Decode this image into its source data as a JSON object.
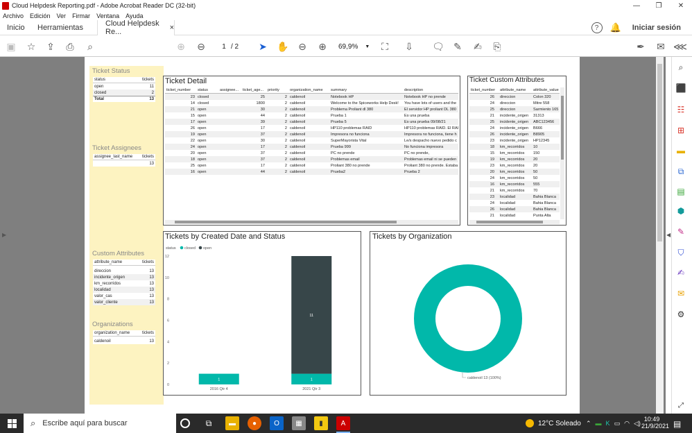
{
  "window": {
    "title": "Cloud Helpdesk Reporting.pdf - Adobe Acrobat Reader DC (32-bit)",
    "min": "—",
    "max": "❐",
    "close": "✕"
  },
  "menu": [
    "Archivo",
    "Edición",
    "Ver",
    "Firmar",
    "Ventana",
    "Ayuda"
  ],
  "tabs": {
    "home": "Inicio",
    "tools": "Herramientas",
    "doc": "Cloud Helpdesk Re...",
    "close": "×",
    "signin": "Iniciar sesión"
  },
  "toolbar": {
    "page_current": "1",
    "page_total": "/ 2",
    "zoom": "69,9%"
  },
  "report": {
    "ticket_status": {
      "title": "Ticket Status",
      "headers": [
        "status",
        "tickets"
      ],
      "rows": [
        [
          "open",
          "11"
        ],
        [
          "closed",
          "2"
        ]
      ],
      "total": [
        "Total",
        "13"
      ]
    },
    "ticket_assignees": {
      "title": "Ticket Assignees",
      "headers": [
        "assignee_last_name",
        "tickets"
      ],
      "rows": [
        [
          "",
          "13"
        ]
      ]
    },
    "custom_attributes": {
      "title": "Custom Attributes",
      "headers": [
        "attribute_name",
        "tickets"
      ],
      "rows": [
        [
          "direccion",
          "13"
        ],
        [
          "incidente_origen",
          "13"
        ],
        [
          "km_recorridos",
          "13"
        ],
        [
          "localidad",
          "13"
        ],
        [
          "valor_cas",
          "13"
        ],
        [
          "valor_cliente",
          "13"
        ]
      ]
    },
    "organizations": {
      "title": "Organizations",
      "headers": [
        "organization_name",
        "tickets"
      ],
      "rows": [
        [
          "caldenoil",
          "13"
        ]
      ]
    },
    "ticket_detail": {
      "title": "Ticket Detail",
      "headers": [
        "ticket_number",
        "status",
        "assignee...",
        "ticket_age...",
        "priority",
        "organization_name",
        "summary",
        "description"
      ],
      "rows": [
        [
          "23",
          "closed",
          "",
          "25",
          "2",
          "caldenoil",
          "Notebook HP",
          "Notebook HP no prende"
        ],
        [
          "14",
          "closed",
          "",
          "1800",
          "2",
          "caldenoil",
          "Welcome to the Spiceworks Help Desk!",
          "You have lots of users and the"
        ],
        [
          "21",
          "open",
          "",
          "30",
          "2",
          "caldenoil",
          "Problema Proliant dl 380",
          "El servidor HP proliant DL 380"
        ],
        [
          "15",
          "open",
          "",
          "44",
          "2",
          "caldenoil",
          "Prueba 1",
          "Es una prueba"
        ],
        [
          "17",
          "open",
          "",
          "39",
          "2",
          "caldenoil",
          "Prueba 5",
          "Es una prueba 09/08/21"
        ],
        [
          "26",
          "open",
          "",
          "17",
          "2",
          "caldenoil",
          "HP110 problemas RAID",
          "HP110 problemas RAID. El RAI"
        ],
        [
          "19",
          "open",
          "",
          "37",
          "2",
          "caldenoil",
          "Impresora no funciona",
          "Impresora no funciona, tiene h"
        ],
        [
          "22",
          "open",
          "",
          "30",
          "2",
          "caldenoil",
          "SuperMayorista Vital",
          "Le/s despacho nuevo pedido c"
        ],
        [
          "24",
          "open",
          "",
          "17",
          "2",
          "caldenoil",
          "Prueba  999",
          "No funciona impresora"
        ],
        [
          "20",
          "open",
          "",
          "37",
          "2",
          "caldenoil",
          "PC no prende",
          "PC no prende,"
        ],
        [
          "18",
          "open",
          "",
          "37",
          "2",
          "caldenoil",
          "Problemas email",
          "Problemas email ni se pueden"
        ],
        [
          "25",
          "open",
          "",
          "17",
          "2",
          "caldenoil",
          "Proliant 380 no prende",
          "Proliant 380 no prende. Estaba"
        ],
        [
          "16",
          "open",
          "",
          "44",
          "2",
          "caldenoil",
          "Prueba2",
          "Prueba 2"
        ]
      ]
    },
    "ticket_custom_attributes": {
      "title": "Ticket Custom Attributes",
      "headers": [
        "ticket_number",
        "attribute_name",
        "attribute_value"
      ],
      "rows": [
        [
          "26",
          "direccion",
          "Colon 320"
        ],
        [
          "24",
          "direccion",
          "Mitre 558"
        ],
        [
          "25",
          "direccion",
          "Sarmiento 165"
        ],
        [
          "21",
          "incidente_origen",
          "31313"
        ],
        [
          "25",
          "incidente_origen",
          "ABC123456"
        ],
        [
          "24",
          "incidente_origen",
          "B666"
        ],
        [
          "26",
          "incidente_origen",
          "B8905"
        ],
        [
          "23",
          "incidente_origen",
          "HP12345"
        ],
        [
          "18",
          "km_recorridos",
          "10"
        ],
        [
          "15",
          "km_recorridos",
          "150"
        ],
        [
          "19",
          "km_recorridos",
          "20"
        ],
        [
          "23",
          "km_recorridos",
          "20"
        ],
        [
          "20",
          "km_recorridos",
          "50"
        ],
        [
          "24",
          "km_recorridos",
          "50"
        ],
        [
          "16",
          "km_recorridos",
          "555"
        ],
        [
          "21",
          "km_recorridos",
          "70"
        ],
        [
          "23",
          "localidad",
          "Bahia Blanca"
        ],
        [
          "24",
          "localidad",
          "Bahia Blanca"
        ],
        [
          "26",
          "localidad",
          "Bahia Blanca"
        ],
        [
          "21",
          "localidad",
          "Punta Alta"
        ]
      ]
    },
    "created_chart_title": "Tickets by Created Date and Status",
    "org_chart_title": "Tickets by Organization"
  },
  "chart_data": [
    {
      "type": "bar",
      "title": "Tickets by Created Date and Status",
      "stacked": true,
      "legend_title": "status",
      "legend_position": "top-left",
      "categories": [
        "2016 Qtr 4",
        "2021 Qtr 3"
      ],
      "series": [
        {
          "name": "closed",
          "values": [
            1,
            1
          ],
          "color": "#01b8aa"
        },
        {
          "name": "open",
          "values": [
            0,
            11
          ],
          "color": "#374649"
        }
      ],
      "ylim": [
        0,
        12
      ],
      "yticks": [
        0,
        2,
        4,
        6,
        8,
        10,
        12
      ]
    },
    {
      "type": "pie",
      "donut": true,
      "title": "Tickets by Organization",
      "slices": [
        {
          "label": "caldenoil",
          "value": 13,
          "label_text": "caldenoil 13 (100%)",
          "color": "#01b8aa"
        }
      ]
    }
  ],
  "taskbar": {
    "search_placeholder": "Escribe aquí para buscar",
    "weather": "12°C  Soleado",
    "time": "10:49",
    "date": "21/9/2021"
  }
}
